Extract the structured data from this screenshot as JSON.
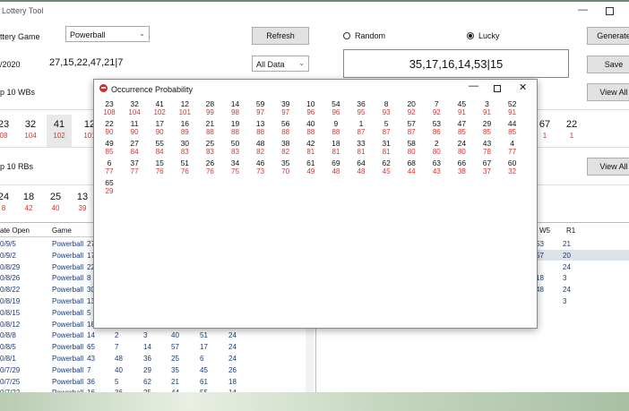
{
  "app": {
    "title": "Lottery Tool"
  },
  "controls": {
    "game_label": "ttery Game",
    "game_value": "Powerball",
    "refresh": "Refresh",
    "radio_random": "Random",
    "radio_lucky": "Lucky",
    "generate": "Generate",
    "save": "Save",
    "view_all_1": "View All",
    "view_all_2": "View All",
    "date_label": "/2020",
    "last_draw": "27,15,22,47,21|7",
    "filter_value": "All Data",
    "lucky_numbers": "35,17,16,14,53|15",
    "top_wb_label": "p 10 WBs",
    "top_rb_label": "p 10 RBs"
  },
  "wb_top": [
    {
      "n": "23",
      "p": "08"
    },
    {
      "n": "32",
      "p": "104"
    },
    {
      "n": "41",
      "p": "102"
    },
    {
      "n": "12",
      "p": "101"
    },
    {
      "n": "67",
      "p": "1"
    },
    {
      "n": "22",
      "p": "1"
    }
  ],
  "rb_top": [
    {
      "n": "24",
      "p": "8"
    },
    {
      "n": "18",
      "p": "42"
    },
    {
      "n": "25",
      "p": "40"
    },
    {
      "n": "13",
      "p": "39"
    }
  ],
  "table": {
    "headers": [
      "ate Open",
      "Game"
    ],
    "right_headers": [
      "W5",
      "R1"
    ],
    "rows": [
      [
        "0/9/5",
        "Powerball",
        "27",
        "",
        "",
        "",
        "",
        ""
      ],
      [
        "0/9/2",
        "Powerball",
        "17",
        "",
        "",
        "",
        "",
        ""
      ],
      [
        "0/8/29",
        "Powerball",
        "22",
        "",
        "",
        "",
        "",
        ""
      ],
      [
        "0/8/26",
        "Powerball",
        "8",
        "",
        "",
        "",
        "",
        ""
      ],
      [
        "0/8/22",
        "Powerball",
        "30",
        "",
        "",
        "",
        "",
        ""
      ],
      [
        "0/8/19",
        "Powerball",
        "13",
        "",
        "",
        "",
        "",
        ""
      ],
      [
        "0/8/15",
        "Powerball",
        "5",
        "",
        "",
        "",
        "",
        ""
      ],
      [
        "0/8/12",
        "Powerball",
        "18",
        "",
        "",
        "",
        "",
        ""
      ],
      [
        "0/8/8",
        "Powerball",
        "14",
        "2",
        "3",
        "40",
        "51",
        "24"
      ],
      [
        "0/8/5",
        "Powerball",
        "65",
        "7",
        "14",
        "57",
        "17",
        "24"
      ],
      [
        "0/8/1",
        "Powerball",
        "43",
        "48",
        "36",
        "25",
        "6",
        "24"
      ],
      [
        "0/7/29",
        "Powerball",
        "7",
        "40",
        "29",
        "35",
        "45",
        "26"
      ],
      [
        "0/7/25",
        "Powerball",
        "36",
        "5",
        "62",
        "21",
        "61",
        "18"
      ],
      [
        "0/7/22",
        "Powerball",
        "16",
        "36",
        "25",
        "44",
        "55",
        "14"
      ]
    ],
    "right_rows": [
      [
        "53",
        "21"
      ],
      [
        "57",
        "20"
      ],
      [
        "",
        "24"
      ],
      [
        "18",
        "3"
      ],
      [
        "48",
        "24"
      ],
      [
        "",
        "3"
      ]
    ]
  },
  "popup": {
    "title": "Occurrence Probability",
    "cells": [
      {
        "n": "23",
        "p": "108"
      },
      {
        "n": "32",
        "p": "104"
      },
      {
        "n": "41",
        "p": "102"
      },
      {
        "n": "12",
        "p": "101"
      },
      {
        "n": "28",
        "p": "99"
      },
      {
        "n": "14",
        "p": "98"
      },
      {
        "n": "59",
        "p": "97"
      },
      {
        "n": "39",
        "p": "97"
      },
      {
        "n": "10",
        "p": "96"
      },
      {
        "n": "54",
        "p": "96"
      },
      {
        "n": "36",
        "p": "95"
      },
      {
        "n": "8",
        "p": "93"
      },
      {
        "n": "20",
        "p": "92"
      },
      {
        "n": "7",
        "p": "92"
      },
      {
        "n": "45",
        "p": "91"
      },
      {
        "n": "3",
        "p": "91"
      },
      {
        "n": "52",
        "p": "91"
      },
      {
        "n": "22",
        "p": "90"
      },
      {
        "n": "11",
        "p": "90"
      },
      {
        "n": "17",
        "p": "90"
      },
      {
        "n": "16",
        "p": "89"
      },
      {
        "n": "21",
        "p": "88"
      },
      {
        "n": "19",
        "p": "88"
      },
      {
        "n": "13",
        "p": "88"
      },
      {
        "n": "56",
        "p": "88"
      },
      {
        "n": "40",
        "p": "88"
      },
      {
        "n": "9",
        "p": "88"
      },
      {
        "n": "1",
        "p": "87"
      },
      {
        "n": "5",
        "p": "87"
      },
      {
        "n": "57",
        "p": "87"
      },
      {
        "n": "53",
        "p": "86"
      },
      {
        "n": "47",
        "p": "85"
      },
      {
        "n": "29",
        "p": "85"
      },
      {
        "n": "44",
        "p": "85"
      },
      {
        "n": "49",
        "p": "85"
      },
      {
        "n": "27",
        "p": "84"
      },
      {
        "n": "55",
        "p": "84"
      },
      {
        "n": "30",
        "p": "83"
      },
      {
        "n": "25",
        "p": "83"
      },
      {
        "n": "50",
        "p": "83"
      },
      {
        "n": "48",
        "p": "82"
      },
      {
        "n": "38",
        "p": "82"
      },
      {
        "n": "42",
        "p": "81"
      },
      {
        "n": "18",
        "p": "81"
      },
      {
        "n": "33",
        "p": "81"
      },
      {
        "n": "31",
        "p": "81"
      },
      {
        "n": "58",
        "p": "80"
      },
      {
        "n": "2",
        "p": "80"
      },
      {
        "n": "24",
        "p": "80"
      },
      {
        "n": "43",
        "p": "78"
      },
      {
        "n": "4",
        "p": "77"
      },
      {
        "n": "6",
        "p": "77"
      },
      {
        "n": "37",
        "p": "77"
      },
      {
        "n": "15",
        "p": "76"
      },
      {
        "n": "51",
        "p": "76"
      },
      {
        "n": "26",
        "p": "76"
      },
      {
        "n": "34",
        "p": "75"
      },
      {
        "n": "46",
        "p": "73"
      },
      {
        "n": "35",
        "p": "70"
      },
      {
        "n": "61",
        "p": "49"
      },
      {
        "n": "69",
        "p": "48"
      },
      {
        "n": "64",
        "p": "48"
      },
      {
        "n": "62",
        "p": "45"
      },
      {
        "n": "68",
        "p": "44"
      },
      {
        "n": "63",
        "p": "43"
      },
      {
        "n": "66",
        "p": "38"
      },
      {
        "n": "67",
        "p": "37"
      },
      {
        "n": "60",
        "p": "32"
      },
      {
        "n": "65",
        "p": "29"
      }
    ]
  }
}
